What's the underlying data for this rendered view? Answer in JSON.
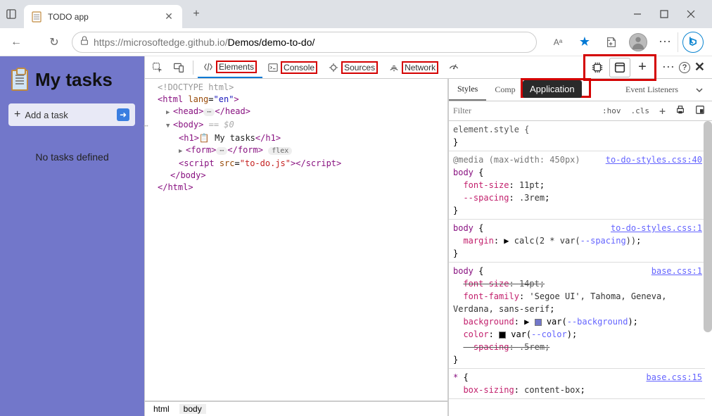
{
  "window": {
    "tab_title": "TODO app"
  },
  "addr": {
    "url_gray1": "https://microsoftedge.github.io/",
    "url_black": "Demos/demo-to-do/",
    "aa": "Aᵃ"
  },
  "app": {
    "heading": "My tasks",
    "add_label": "Add a task",
    "empty": "No tasks defined"
  },
  "dt": {
    "tabs": {
      "elements": "Elements",
      "console": "Console",
      "sources": "Sources",
      "network": "Network"
    },
    "more": "⋯",
    "tooltip": "Application",
    "styles_tabs": {
      "styles": "Styles",
      "computed": "Comp",
      "listeners": "Event Listeners"
    },
    "filter_ph": "Filter",
    "hov": ":hov",
    "cls": ".cls",
    "crumbs": {
      "html": "html",
      "body": "body"
    }
  },
  "dom": {
    "l1": "<!DOCTYPE html>",
    "html_open": "html",
    "lang_attr": "lang",
    "lang_val": "\"en\"",
    "head": "head",
    "body": "body",
    "body_sel": "== $0",
    "h1": "h1",
    "h1_text": " My tasks",
    "form": "form",
    "flex": "flex",
    "script": "script",
    "src": "src",
    "src_v": "\"to-do.js\"",
    "close_body": "</",
    "close_html": "</"
  },
  "s": {
    "r0": "element.style {",
    "media": "@media (max-width: 450px)",
    "r1_sel": "body",
    "link1": "to-do-styles.css:40",
    "r1_p1": "font-size",
    "r1_v1": "11pt",
    "r1_p2": "--spacing",
    "r1_v2": ".3rem",
    "r2_sel": "body",
    "link2": "to-do-styles.css:1",
    "r2_p1": "margin",
    "r2_v1": "calc(2 * var(",
    "r2_var": "--spacing",
    "r2_v1b": "))",
    "r3_sel": "body",
    "link3": "base.css:1",
    "r3_p1": "font-size",
    "r3_v1": "14pt",
    "r3_p2": "font-family",
    "r3_v2": "'Segoe UI', Tahoma, Geneva, Verdana, sans-serif",
    "r3_p3": "background",
    "r3_var3": "--background",
    "r3_p4": "color",
    "r3_var4": "--color",
    "r3_p5": "--spacing",
    "r3_v5": ".5rem",
    "r4_sel": "*",
    "link4": "base.css:15",
    "r4_p1": "box-sizing",
    "r4_v1": "content-box"
  }
}
